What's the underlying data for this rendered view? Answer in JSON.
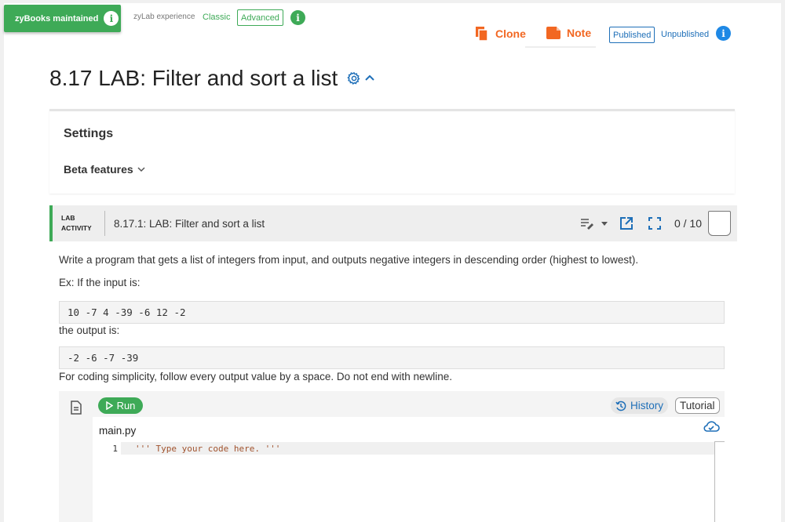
{
  "header": {
    "maintained_label": "zyBooks maintained",
    "zylab_experience_label": "zyLab experience",
    "classic_label": "Classic",
    "advanced_label": "Advanced",
    "clone_label": "Clone",
    "note_label": "Note",
    "published_label": "Published",
    "unpublished_label": "Unpublished",
    "info_glyph": "i"
  },
  "page": {
    "title": "8.17 LAB: Filter and sort a list"
  },
  "settings": {
    "title": "Settings",
    "beta_label": "Beta features"
  },
  "lab": {
    "activity_line1": "LAB",
    "activity_line2": "ACTIVITY",
    "title": "8.17.1: LAB: Filter and sort a list",
    "score": "0 / 10"
  },
  "content": {
    "description": "Write a program that gets a list of integers from input, and outputs negative integers in descending order (highest to lowest).",
    "example_label": "Ex: If the input is:",
    "example_input": "10 -7 4 -39 -6 12 -2",
    "output_label": "the output is:",
    "example_output": "-2 -6 -7 -39",
    "note": "For coding simplicity, follow every output value by a space. Do not end with newline."
  },
  "editor": {
    "run_label": "Run",
    "history_label": "History",
    "tutorial_label": "Tutorial",
    "filename": "main.py",
    "lines": [
      {
        "number": "1",
        "code": "''' Type your code here. '''"
      }
    ]
  },
  "colors": {
    "green": "#3eaa57",
    "orange": "#f26722",
    "blue": "#1e6fb8"
  }
}
